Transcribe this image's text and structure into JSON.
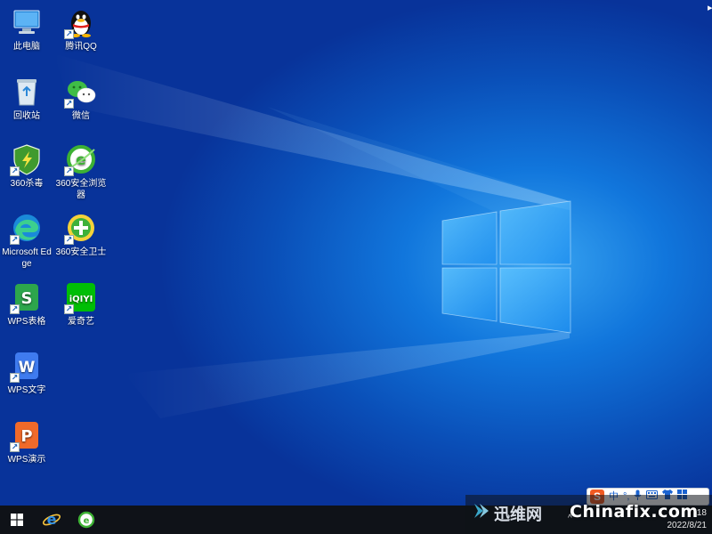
{
  "desktop": {
    "icons": [
      {
        "label": "此电脑"
      },
      {
        "label": "腾讯QQ"
      },
      {
        "label": "回收站"
      },
      {
        "label": "微信"
      },
      {
        "label": "360杀毒"
      },
      {
        "label": "360安全浏览器"
      },
      {
        "label": "Microsoft Edge"
      },
      {
        "label": "360安全卫士"
      },
      {
        "label": "WPS表格"
      },
      {
        "label": "爱奇艺"
      },
      {
        "label": "WPS文字"
      },
      {
        "label": "WPS演示"
      }
    ],
    "shortcut_glyph": "↗",
    "iqiyi_text": "iQIYI"
  },
  "ime": {
    "logo": "S",
    "mode": "中",
    "punct": "°,",
    "mic": "🎤",
    "keyboard": "⌨",
    "skin": "👕",
    "menu": "▦"
  },
  "tray": {
    "arrow": "^",
    "time": ":18",
    "date": "2022/8/21"
  },
  "watermark": {
    "cn": "迅维网",
    "en": "Chinafix.com"
  },
  "top_right_glyph": "▸",
  "colors": {
    "desktop_blue": "#0a4fb8",
    "taskbar": "#0f1218",
    "wps_sheet": "#2da64c",
    "wps_writer": "#3f7bef",
    "wps_show": "#f06a2a",
    "iqiyi": "#00be06",
    "ime_logo": "#f05a22"
  }
}
